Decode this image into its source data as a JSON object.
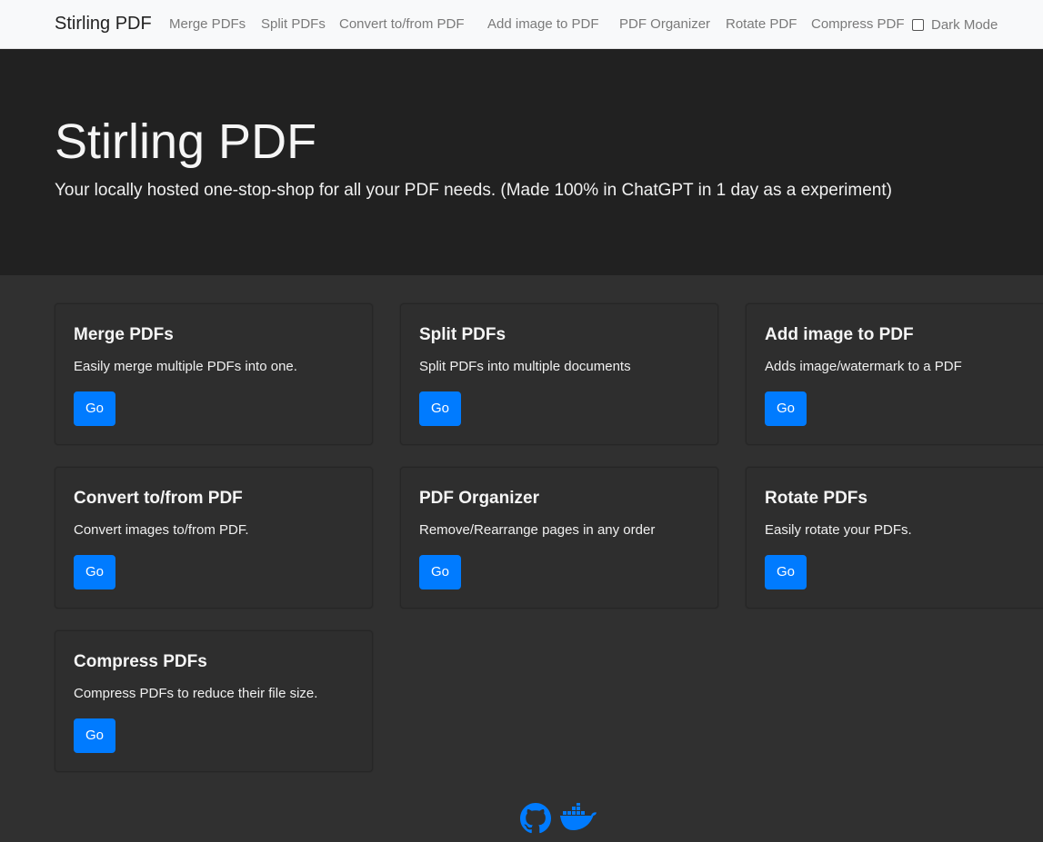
{
  "navbar": {
    "brand": "Stirling PDF",
    "links": [
      {
        "label": "Merge PDFs"
      },
      {
        "label": "Split PDFs"
      },
      {
        "label": "Convert to/from PDF"
      },
      {
        "label": "Add image to PDF"
      },
      {
        "label": "PDF Organizer"
      },
      {
        "label": "Rotate PDF"
      },
      {
        "label": "Compress PDF"
      }
    ],
    "dark_mode_label": "Dark Mode",
    "dark_mode_checked": false
  },
  "hero": {
    "title": "Stirling PDF",
    "subtitle": "Your locally hosted one-stop-shop for all your PDF needs. (Made 100% in ChatGPT in 1 day as a experiment)"
  },
  "cards": [
    {
      "title": "Merge PDFs",
      "text": "Easily merge multiple PDFs into one.",
      "button": "Go"
    },
    {
      "title": "Split PDFs",
      "text": "Split PDFs into multiple documents",
      "button": "Go"
    },
    {
      "title": "Add image to PDF",
      "text": "Adds image/watermark to a PDF",
      "button": "Go"
    },
    {
      "title": "Convert to/from PDF",
      "text": "Convert images to/from PDF.",
      "button": "Go"
    },
    {
      "title": "PDF Organizer",
      "text": "Remove/Rearrange pages in any order",
      "button": "Go"
    },
    {
      "title": "Rotate PDFs",
      "text": "Easily rotate your PDFs.",
      "button": "Go"
    },
    {
      "title": "Compress PDFs",
      "text": "Compress PDFs to reduce their file size.",
      "button": "Go"
    }
  ],
  "footer": {
    "icons": [
      "github-icon",
      "docker-icon"
    ]
  },
  "colors": {
    "accent": "#007bff",
    "navbar_bg": "#f8f9fa",
    "hero_bg": "#212121",
    "page_bg": "#303030",
    "card_bg": "#2e2e2e"
  }
}
